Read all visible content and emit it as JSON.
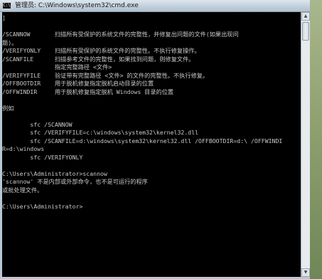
{
  "window": {
    "title": "管理员: C:\\Windows\\system32\\cmd.exe",
    "icon_label": "C:\\"
  },
  "console": {
    "lines": [
      "]",
      "",
      "/SCANNOW       扫描所有受保护的系统文件的完整性，并修复出问题的文件(如果出现问",
      "题)。",
      "/VERIFYONLY    扫描所有受保护的系统文件的完整性。不执行修复操作。",
      "/SCANFILE      扫描参考文件的完整性，如果找到问题，则修复文件。",
      "               指定完整路径 <文件>",
      "/VERIFYFILE    验证带有完整路径 <文件> 的文件的完整性。不执行修复。",
      "/OFFBOOTDIR    用于脱机修复指定脱机启动目录的位置",
      "/OFFWINDIR     用于脱机修复指定脱机 Windows 目录的位置",
      "",
      "例如",
      "",
      "        sfc /SCANNOW",
      "        sfc /VERIFYFILE=c:\\windows\\system32\\kernel32.dll",
      "        sfc /SCANFILE=d:\\windows\\system32\\kernel32.dll /OFFBOOTDIR=d:\\ /OFFWINDI",
      "R=d:\\windows",
      "        sfc /VERIFYONLY",
      "",
      "C:\\Users\\Administrator>scannow",
      "'scannow' 不是内部或外部命令，也不是可运行的程序",
      "或批处理文件。",
      "",
      "C:\\Users\\Administrator>"
    ]
  },
  "scrollbar": {
    "up_icon": "scroll-up-arrow-icon",
    "down_icon": "scroll-down-arrow-icon"
  }
}
